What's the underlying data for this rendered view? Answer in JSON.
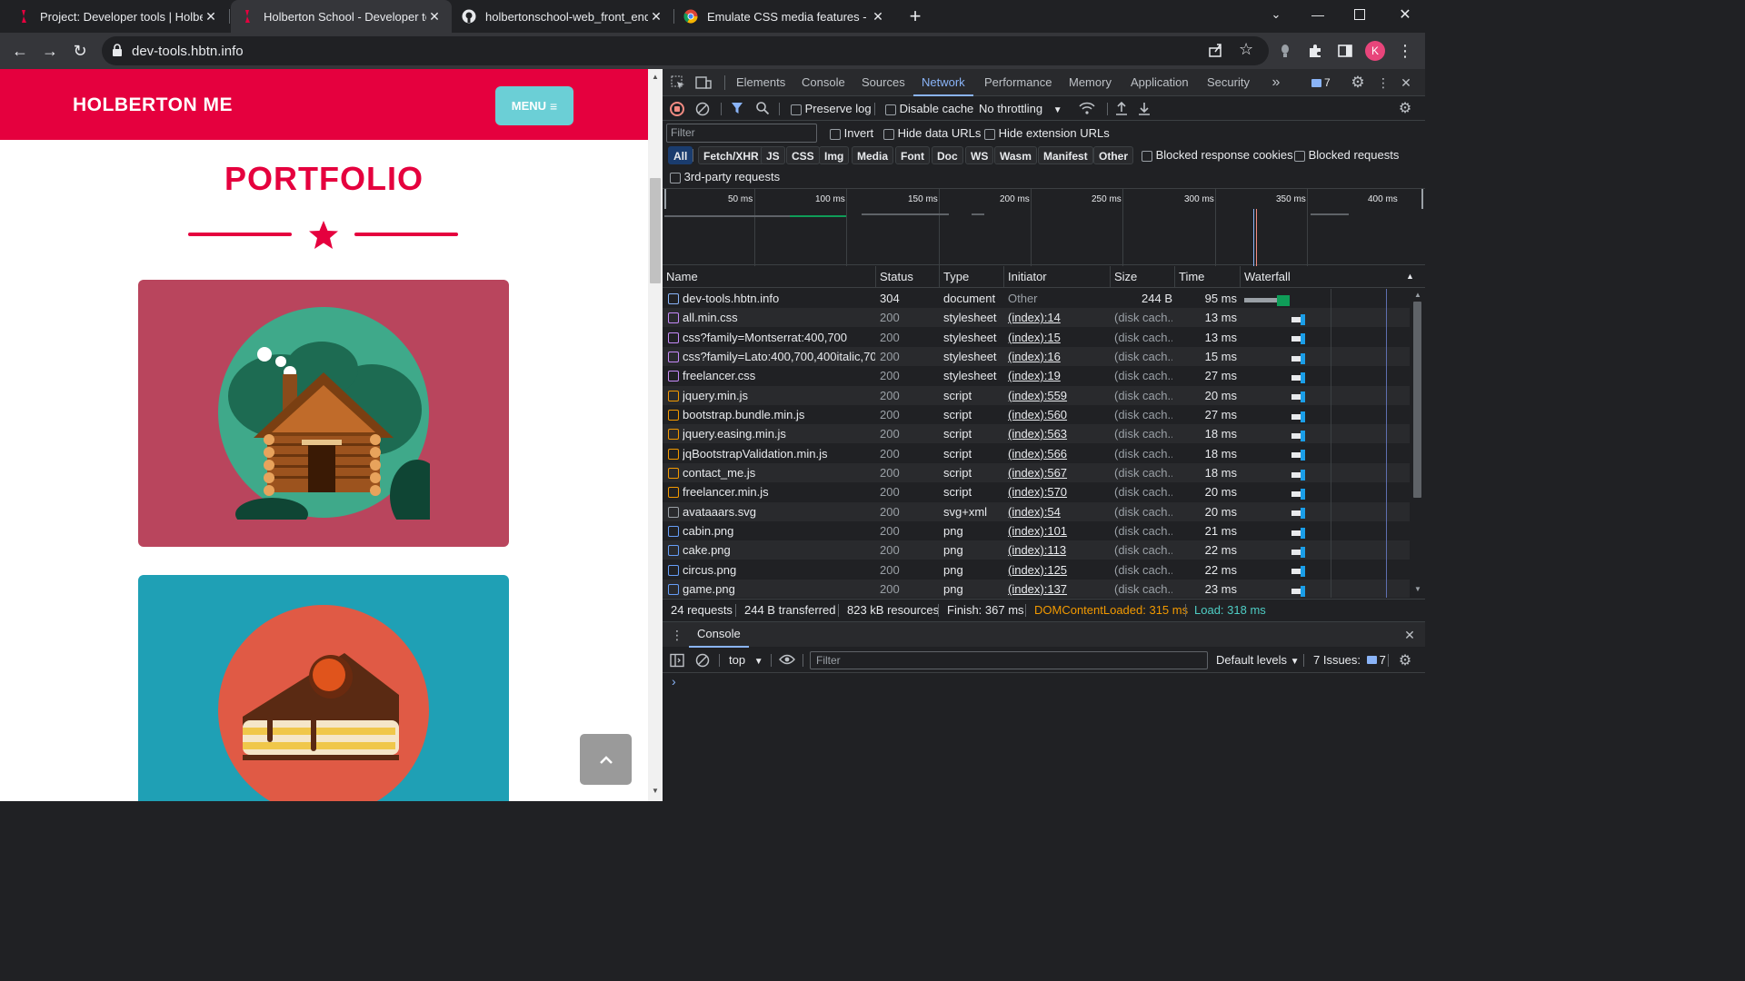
{
  "tabs": [
    {
      "title": "Project: Developer tools | Holberton"
    },
    {
      "title": "Holberton School - Developer tools"
    },
    {
      "title": "holbertonschool-web_front_end"
    },
    {
      "title": "Emulate CSS media features - Chrome"
    }
  ],
  "toolbar": {
    "url": "dev-tools.hbtn.info",
    "profile_initial": "K"
  },
  "page": {
    "brand": "HOLBERTON ME",
    "menu_label": "MENU",
    "title": "PORTFOLIO",
    "colors": {
      "header": "#e5003e",
      "menu": "#6bcfd6",
      "card1": "#b9455d",
      "card2": "#1fa0b5"
    }
  },
  "devtools": {
    "panels": [
      "Elements",
      "Console",
      "Sources",
      "Network",
      "Performance",
      "Memory",
      "Application",
      "Security"
    ],
    "active_panel": "Network",
    "issues_count": "7",
    "network_toolbar": {
      "preserve_log": "Preserve log",
      "disable_cache": "Disable cache",
      "throttling": "No throttling"
    },
    "filter_placeholder": "Filter",
    "filter_options": {
      "invert": "Invert",
      "hide_data_urls": "Hide data URLs",
      "hide_ext_urls": "Hide extension URLs"
    },
    "type_filters": [
      "All",
      "Fetch/XHR",
      "JS",
      "CSS",
      "Img",
      "Media",
      "Font",
      "Doc",
      "WS",
      "Wasm",
      "Manifest",
      "Other"
    ],
    "blocked_cookies": "Blocked response cookies",
    "blocked_requests": "Blocked requests",
    "third_party": "3rd-party requests",
    "timeline_ticks": [
      "50 ms",
      "100 ms",
      "150 ms",
      "200 ms",
      "250 ms",
      "300 ms",
      "350 ms",
      "400 ms"
    ],
    "columns": {
      "name": "Name",
      "status": "Status",
      "type": "Type",
      "initiator": "Initiator",
      "size": "Size",
      "time": "Time",
      "waterfall": "Waterfall"
    },
    "requests": [
      {
        "name": "dev-tools.hbtn.info",
        "status": "304",
        "type": "document",
        "initiator": "Other",
        "size": "244 B",
        "time": "95 ms",
        "kind": "doc"
      },
      {
        "name": "all.min.css",
        "status": "200",
        "type": "stylesheet",
        "initiator": "(index):14",
        "size": "(disk cach...",
        "time": "13 ms",
        "kind": "css"
      },
      {
        "name": "css?family=Montserrat:400,700",
        "status": "200",
        "type": "stylesheet",
        "initiator": "(index):15",
        "size": "(disk cach...",
        "time": "13 ms",
        "kind": "css"
      },
      {
        "name": "css?family=Lato:400,700,400italic,70...",
        "status": "200",
        "type": "stylesheet",
        "initiator": "(index):16",
        "size": "(disk cach...",
        "time": "15 ms",
        "kind": "css"
      },
      {
        "name": "freelancer.css",
        "status": "200",
        "type": "stylesheet",
        "initiator": "(index):19",
        "size": "(disk cach...",
        "time": "27 ms",
        "kind": "css"
      },
      {
        "name": "jquery.min.js",
        "status": "200",
        "type": "script",
        "initiator": "(index):559",
        "size": "(disk cach...",
        "time": "20 ms",
        "kind": "js"
      },
      {
        "name": "bootstrap.bundle.min.js",
        "status": "200",
        "type": "script",
        "initiator": "(index):560",
        "size": "(disk cach...",
        "time": "27 ms",
        "kind": "js"
      },
      {
        "name": "jquery.easing.min.js",
        "status": "200",
        "type": "script",
        "initiator": "(index):563",
        "size": "(disk cach...",
        "time": "18 ms",
        "kind": "js"
      },
      {
        "name": "jqBootstrapValidation.min.js",
        "status": "200",
        "type": "script",
        "initiator": "(index):566",
        "size": "(disk cach...",
        "time": "18 ms",
        "kind": "js"
      },
      {
        "name": "contact_me.js",
        "status": "200",
        "type": "script",
        "initiator": "(index):567",
        "size": "(disk cach...",
        "time": "18 ms",
        "kind": "js"
      },
      {
        "name": "freelancer.min.js",
        "status": "200",
        "type": "script",
        "initiator": "(index):570",
        "size": "(disk cach...",
        "time": "20 ms",
        "kind": "js"
      },
      {
        "name": "avataaars.svg",
        "status": "200",
        "type": "svg+xml",
        "initiator": "(index):54",
        "size": "(disk cach...",
        "time": "20 ms",
        "kind": "svg"
      },
      {
        "name": "cabin.png",
        "status": "200",
        "type": "png",
        "initiator": "(index):101",
        "size": "(disk cach...",
        "time": "21 ms",
        "kind": "img"
      },
      {
        "name": "cake.png",
        "status": "200",
        "type": "png",
        "initiator": "(index):113",
        "size": "(disk cach...",
        "time": "22 ms",
        "kind": "img"
      },
      {
        "name": "circus.png",
        "status": "200",
        "type": "png",
        "initiator": "(index):125",
        "size": "(disk cach...",
        "time": "22 ms",
        "kind": "img"
      },
      {
        "name": "game.png",
        "status": "200",
        "type": "png",
        "initiator": "(index):137",
        "size": "(disk cach...",
        "time": "23 ms",
        "kind": "img"
      }
    ],
    "summary": {
      "requests": "24 requests",
      "transferred": "244 B transferred",
      "resources": "823 kB resources",
      "finish": "Finish: 367 ms",
      "dcl": "DOMContentLoaded: 315 ms",
      "load": "Load: 318 ms"
    },
    "drawer": {
      "tab": "Console",
      "context": "top",
      "filter_placeholder": "Filter",
      "levels": "Default levels",
      "issues_label": "7 Issues:",
      "issues_count": "7",
      "prompt": "›"
    }
  }
}
